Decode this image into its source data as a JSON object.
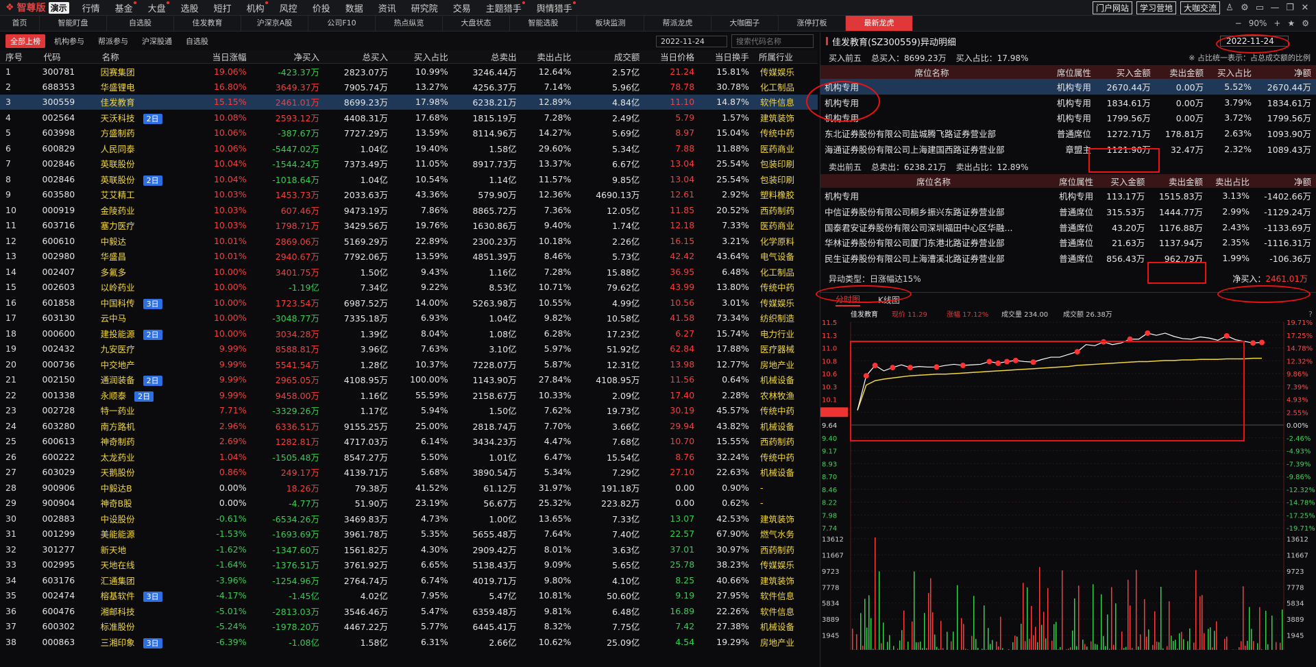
{
  "app": {
    "logo_text": "智尊版",
    "logo_ver": "演示"
  },
  "menu": [
    "行情",
    "基金",
    "大盘",
    "选股",
    "短打",
    "机构",
    "风控",
    "价投",
    "数据",
    "资讯",
    "研究院",
    "交易",
    "主题猎手",
    "舆情猎手"
  ],
  "top_buttons": [
    "门户网站",
    "学习营地",
    "大咖交流"
  ],
  "tabs": [
    "首页",
    "智能盯盘",
    "自选股",
    "佳发教育",
    "沪深京A股",
    "公司F10",
    "热点纵览",
    "大盘状态",
    "智能选股",
    "板块监测",
    "帮派龙虎",
    "大咖圈子",
    "涨停打板",
    "最新龙虎"
  ],
  "tab_zoom": "90%",
  "subtabs": [
    "全部上榜",
    "机构参与",
    "帮派参与",
    "沪深股通",
    "自选股"
  ],
  "left_date": "2022-11-24",
  "search_placeholder": "搜索代码名称",
  "columns": [
    "序号",
    "代码",
    "名称",
    "当日涨幅",
    "净买入",
    "总买入",
    "买入占比",
    "总卖出",
    "卖出占比",
    "成交额",
    "当日价格",
    "当日换手",
    "所属行业"
  ],
  "rows": [
    [
      "1",
      "300781",
      "因赛集团",
      "",
      "19.06%",
      "-423.37万",
      "2823.07万",
      "10.99%",
      "3246.44万",
      "12.64%",
      "2.57亿",
      "21.24",
      "15.81%",
      "传媒娱乐"
    ],
    [
      "2",
      "688353",
      "华盛锂电",
      "",
      "16.80%",
      "3649.37万",
      "7905.74万",
      "13.27%",
      "4256.37万",
      "7.14%",
      "5.96亿",
      "78.78",
      "30.78%",
      "化工制品"
    ],
    [
      "3",
      "300559",
      "佳发教育",
      "",
      "15.15%",
      "2461.01万",
      "8699.23万",
      "17.98%",
      "6238.21万",
      "12.89%",
      "4.84亿",
      "11.10",
      "14.87%",
      "软件信息"
    ],
    [
      "4",
      "002564",
      "天沃科技",
      "2日",
      "10.08%",
      "2593.12万",
      "4408.31万",
      "17.68%",
      "1815.19万",
      "7.28%",
      "2.49亿",
      "5.79",
      "1.57%",
      "建筑装饰"
    ],
    [
      "5",
      "603998",
      "方盛制药",
      "",
      "10.06%",
      "-387.67万",
      "7727.29万",
      "13.59%",
      "8114.96万",
      "14.27%",
      "5.69亿",
      "8.97",
      "15.04%",
      "传统中药"
    ],
    [
      "6",
      "600829",
      "人民同泰",
      "",
      "10.06%",
      "-5447.02万",
      "1.04亿",
      "19.40%",
      "1.58亿",
      "29.60%",
      "5.34亿",
      "7.88",
      "11.88%",
      "医药商业"
    ],
    [
      "7",
      "002846",
      "英联股份",
      "",
      "10.04%",
      "-1544.24万",
      "7373.49万",
      "11.05%",
      "8917.73万",
      "13.37%",
      "6.67亿",
      "13.04",
      "25.54%",
      "包装印刷"
    ],
    [
      "8",
      "002846",
      "英联股份",
      "2日",
      "10.04%",
      "-1018.64万",
      "1.04亿",
      "10.54%",
      "1.14亿",
      "11.57%",
      "9.85亿",
      "13.04",
      "25.54%",
      "包装印刷"
    ],
    [
      "9",
      "603580",
      "艾艾精工",
      "",
      "10.03%",
      "1453.73万",
      "2033.63万",
      "43.36%",
      "579.90万",
      "12.36%",
      "4690.13万",
      "12.61",
      "2.92%",
      "塑料橡胶"
    ],
    [
      "10",
      "000919",
      "金陵药业",
      "",
      "10.03%",
      "607.46万",
      "9473.19万",
      "7.86%",
      "8865.72万",
      "7.36%",
      "12.05亿",
      "11.85",
      "20.52%",
      "西药制药"
    ],
    [
      "11",
      "603716",
      "塞力医疗",
      "",
      "10.03%",
      "1798.71万",
      "3429.56万",
      "19.76%",
      "1630.86万",
      "9.40%",
      "1.74亿",
      "12.18",
      "7.33%",
      "医药商业"
    ],
    [
      "12",
      "600610",
      "中毅达",
      "",
      "10.01%",
      "2869.06万",
      "5169.29万",
      "22.89%",
      "2300.23万",
      "10.18%",
      "2.26亿",
      "16.15",
      "3.21%",
      "化学原料"
    ],
    [
      "13",
      "002980",
      "华盛昌",
      "",
      "10.01%",
      "2940.67万",
      "7792.06万",
      "13.59%",
      "4851.39万",
      "8.46%",
      "5.73亿",
      "42.42",
      "43.64%",
      "电气设备"
    ],
    [
      "14",
      "002407",
      "多氟多",
      "",
      "10.00%",
      "3401.75万",
      "1.50亿",
      "9.43%",
      "1.16亿",
      "7.28%",
      "15.88亿",
      "36.95",
      "6.48%",
      "化工制品"
    ],
    [
      "15",
      "002603",
      "以岭药业",
      "",
      "10.00%",
      "-1.19亿",
      "7.34亿",
      "9.22%",
      "8.53亿",
      "10.71%",
      "79.62亿",
      "43.99",
      "13.80%",
      "传统中药"
    ],
    [
      "16",
      "601858",
      "中国科传",
      "3日",
      "10.00%",
      "1723.54万",
      "6987.52万",
      "14.00%",
      "5263.98万",
      "10.55%",
      "4.99亿",
      "10.56",
      "3.01%",
      "传媒娱乐"
    ],
    [
      "17",
      "603130",
      "云中马",
      "",
      "10.00%",
      "-3048.77万",
      "7335.18万",
      "6.93%",
      "1.04亿",
      "9.82%",
      "10.58亿",
      "41.58",
      "73.34%",
      "纺织制造"
    ],
    [
      "18",
      "000600",
      "建投能源",
      "2日",
      "10.00%",
      "3034.28万",
      "1.39亿",
      "8.04%",
      "1.08亿",
      "6.28%",
      "17.23亿",
      "6.27",
      "15.74%",
      "电力行业"
    ],
    [
      "19",
      "002432",
      "九安医疗",
      "",
      "9.99%",
      "8588.81万",
      "3.96亿",
      "7.63%",
      "3.10亿",
      "5.97%",
      "51.92亿",
      "62.84",
      "17.88%",
      "医疗器械"
    ],
    [
      "20",
      "000736",
      "中交地产",
      "",
      "9.99%",
      "5541.54万",
      "1.28亿",
      "10.37%",
      "7228.07万",
      "5.87%",
      "12.31亿",
      "13.98",
      "12.77%",
      "房地产业"
    ],
    [
      "21",
      "002150",
      "通润装备",
      "2日",
      "9.99%",
      "2965.05万",
      "4108.95万",
      "100.00%",
      "1143.90万",
      "27.84%",
      "4108.95万",
      "11.56",
      "0.64%",
      "机械设备"
    ],
    [
      "22",
      "001338",
      "永顺泰",
      "2日",
      "9.99%",
      "9458.00万",
      "1.16亿",
      "55.59%",
      "2158.67万",
      "10.33%",
      "2.09亿",
      "17.40",
      "2.28%",
      "农林牧渔"
    ],
    [
      "23",
      "002728",
      "特一药业",
      "",
      "7.71%",
      "-3329.26万",
      "1.17亿",
      "5.94%",
      "1.50亿",
      "7.62%",
      "19.73亿",
      "30.19",
      "45.57%",
      "传统中药"
    ],
    [
      "24",
      "603280",
      "南方路机",
      "",
      "2.96%",
      "6336.51万",
      "9155.25万",
      "25.00%",
      "2818.74万",
      "7.70%",
      "3.66亿",
      "29.94",
      "43.82%",
      "机械设备"
    ],
    [
      "25",
      "600613",
      "神奇制药",
      "",
      "2.69%",
      "1282.81万",
      "4717.03万",
      "6.14%",
      "3434.23万",
      "4.47%",
      "7.68亿",
      "10.70",
      "15.55%",
      "西药制药"
    ],
    [
      "26",
      "600222",
      "太龙药业",
      "",
      "1.04%",
      "-1505.48万",
      "8547.27万",
      "5.50%",
      "1.01亿",
      "6.47%",
      "15.54亿",
      "8.76",
      "32.24%",
      "传统中药"
    ],
    [
      "27",
      "603029",
      "天鹅股份",
      "",
      "0.86%",
      "249.17万",
      "4139.71万",
      "5.68%",
      "3890.54万",
      "5.34%",
      "7.29亿",
      "27.10",
      "22.63%",
      "机械设备"
    ],
    [
      "28",
      "900906",
      "中毅达B",
      "",
      "0.00%",
      "18.26万",
      "79.38万",
      "41.52%",
      "61.12万",
      "31.97%",
      "191.18万",
      "0.00",
      "0.90%",
      "-"
    ],
    [
      "29",
      "900904",
      "神奇B股",
      "",
      "0.00%",
      "-4.77万",
      "51.90万",
      "23.19%",
      "56.67万",
      "25.32%",
      "223.82万",
      "0.00",
      "0.62%",
      "-"
    ],
    [
      "30",
      "002883",
      "中设股份",
      "",
      "-0.61%",
      "-6534.26万",
      "3469.83万",
      "4.73%",
      "1.00亿",
      "13.65%",
      "7.33亿",
      "13.07",
      "42.53%",
      "建筑装饰"
    ],
    [
      "31",
      "001299",
      "美能能源",
      "",
      "-1.53%",
      "-1693.69万",
      "3961.78万",
      "5.35%",
      "5655.48万",
      "7.64%",
      "7.40亿",
      "22.57",
      "67.90%",
      "燃气水务"
    ],
    [
      "32",
      "301277",
      "新天地",
      "",
      "-1.62%",
      "-1347.60万",
      "1561.82万",
      "4.30%",
      "2909.42万",
      "8.01%",
      "3.63亿",
      "37.01",
      "30.97%",
      "西药制药"
    ],
    [
      "33",
      "002995",
      "天地在线",
      "",
      "-1.64%",
      "-1376.51万",
      "3761.92万",
      "6.65%",
      "5138.43万",
      "9.09%",
      "5.65亿",
      "25.78",
      "38.23%",
      "传媒娱乐"
    ],
    [
      "34",
      "603176",
      "汇通集团",
      "",
      "-3.96%",
      "-1254.96万",
      "2764.74万",
      "6.74%",
      "4019.71万",
      "9.80%",
      "4.10亿",
      "8.25",
      "40.66%",
      "建筑装饰"
    ],
    [
      "35",
      "002474",
      "榕基软件",
      "3日",
      "-4.17%",
      "-1.45亿",
      "4.02亿",
      "7.95%",
      "5.47亿",
      "10.81%",
      "50.60亿",
      "9.19",
      "27.95%",
      "软件信息"
    ],
    [
      "36",
      "600476",
      "湘邮科技",
      "",
      "-5.01%",
      "-2813.03万",
      "3546.46万",
      "5.47%",
      "6359.48万",
      "9.81%",
      "6.48亿",
      "16.89",
      "22.26%",
      "软件信息"
    ],
    [
      "37",
      "600302",
      "标准股份",
      "",
      "-5.24%",
      "-1978.20万",
      "4467.22万",
      "5.77%",
      "6445.41万",
      "8.32%",
      "7.75亿",
      "7.42",
      "27.38%",
      "机械设备"
    ],
    [
      "38",
      "000863",
      "三湘印象",
      "3日",
      "-6.39%",
      "-1.08亿",
      "1.58亿",
      "6.31%",
      "2.66亿",
      "10.62%",
      "25.09亿",
      "4.54",
      "19.29%",
      "房地产业"
    ]
  ],
  "detail": {
    "title": "佳发教育(SZ300559)异动明细",
    "date": "2022-11-24",
    "buy_label": "买入前五",
    "buy_total": "总买入：8699.23万",
    "buy_ratio": "买入占比：17.98%",
    "note": "※ 占比统一表示：占总成交额的比例",
    "seat_cols": [
      "席位名称",
      "席位属性",
      "买入金额",
      "卖出金额",
      "买入占比",
      "净额"
    ],
    "buy_rows": [
      [
        "机构专用",
        "机构专用",
        "2670.44万",
        "0.00万",
        "5.52%",
        "2670.44万"
      ],
      [
        "机构专用",
        "机构专用",
        "1834.61万",
        "0.00万",
        "3.79%",
        "1834.61万"
      ],
      [
        "机构专用",
        "机构专用",
        "1799.56万",
        "0.00万",
        "3.72%",
        "1799.56万"
      ],
      [
        "东北证券股份有限公司盐城腾飞路证券营业部",
        "普通席位",
        "1272.71万",
        "178.81万",
        "2.63%",
        "1093.90万"
      ],
      [
        "海通证券股份有限公司上海建国西路证券营业部",
        "章盟主",
        "1121.90万",
        "32.47万",
        "2.32%",
        "1089.43万"
      ]
    ],
    "sell_label": "卖出前五",
    "sell_total": "总卖出：6238.21万",
    "sell_ratio": "卖出占比：12.89%",
    "sell_cols": [
      "席位名称",
      "席位属性",
      "买入金额",
      "卖出金额",
      "卖出占比",
      "净额"
    ],
    "sell_rows": [
      [
        "机构专用",
        "机构专用",
        "113.17万",
        "1515.83万",
        "3.13%",
        "-1402.66万"
      ],
      [
        "中信证券股份有限公司桐乡振兴东路证券营业部",
        "普通席位",
        "315.53万",
        "1444.77万",
        "2.99%",
        "-1129.24万"
      ],
      [
        "国泰君安证券股份有限公司深圳福田中心区华融...",
        "普通席位",
        "43.20万",
        "1176.88万",
        "2.43%",
        "-1133.69万"
      ],
      [
        "华林证券股份有限公司厦门东港北路证券营业部",
        "普通席位",
        "21.63万",
        "1137.94万",
        "2.35%",
        "-1116.31万"
      ],
      [
        "民生证券股份有限公司上海漕溪北路证券营业部",
        "普通席位",
        "856.43万",
        "962.79万",
        "1.99%",
        "-106.36万"
      ]
    ],
    "abn_type": "异动类型：日涨幅达15%",
    "net_buy_label": "净买入：",
    "net_buy": "2461.01万"
  },
  "chart": {
    "tabs": [
      "分时图",
      "K线图"
    ],
    "info_name": "佳发教育",
    "info_price": "现价 11.29",
    "info_pct": "涨幅 17.12%",
    "info_vol": "成交量 234.00",
    "info_amt": "成交额 26.38万",
    "left_ticks": [
      "11.5",
      "11.3",
      "11.0",
      "10.8",
      "10.6",
      "10.3",
      "10.1",
      "9.89",
      "9.64",
      "9.40",
      "9.17",
      "8.93",
      "8.70",
      "8.46",
      "8.22",
      "7.98",
      "7.74"
    ],
    "right_ticks": [
      "19.71%",
      "17.25%",
      "14.78%",
      "12.32%",
      "9.86%",
      "7.39%",
      "4.93%",
      "2.55%",
      "0.00%",
      "-2.46%",
      "-4.93%",
      "-7.39%",
      "-9.86%",
      "-12.32%",
      "-14.78%",
      "-17.25%",
      "-19.71%"
    ],
    "vol_ticks": [
      "13612",
      "11667",
      "9723",
      "7778",
      "5834",
      "3889",
      "1945"
    ]
  },
  "chart_data": {
    "type": "line",
    "series": [
      {
        "values": [
          9.89,
          10.52,
          10.71,
          10.61,
          10.67,
          10.72,
          10.67,
          10.69,
          10.68,
          10.68,
          10.71,
          10.73,
          10.71,
          10.72,
          10.73,
          10.78,
          10.75,
          10.78,
          10.8,
          10.78,
          10.77,
          10.82,
          10.86,
          10.86,
          10.91,
          10.96,
          11.09,
          11.07,
          11.14,
          11.09,
          11.12,
          11.19,
          11.19,
          11.3,
          11.26,
          11.3,
          11.24,
          11.2,
          11.19,
          11.23,
          11.21,
          11.17,
          11.25,
          11.18,
          11.15,
          11.12,
          11.13
        ]
      },
      {
        "values": [
          9.89,
          10.35,
          10.43,
          10.46,
          10.48,
          10.5,
          10.52,
          10.53,
          10.54,
          10.55,
          10.55,
          10.56,
          10.57,
          10.58,
          10.59,
          10.6,
          10.61,
          10.62,
          10.63,
          10.64,
          10.65,
          10.66,
          10.67,
          10.68,
          10.69,
          10.71,
          10.72,
          10.73,
          10.74,
          10.75,
          10.76,
          10.77,
          10.78,
          10.78,
          10.79,
          10.8,
          10.8,
          10.81,
          10.81,
          10.82,
          10.82,
          10.82,
          10.83,
          10.83,
          10.83,
          10.84,
          10.84
        ]
      }
    ]
  }
}
